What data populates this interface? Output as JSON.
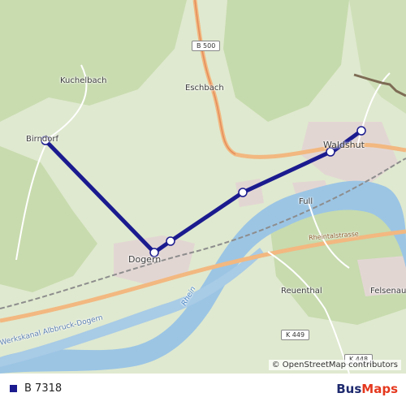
{
  "map": {
    "labels": {
      "kuchelbach": "Kuchelbach",
      "eschbach": "Eschbach",
      "birndorf": "Birndorf",
      "waldshut": "Waldshut",
      "full": "Full",
      "dogern": "Dogern",
      "reuenthal": "Reuenthal",
      "felsenau": "Felsenau",
      "rhein": "Rhein",
      "rheintalstrasse": "Rheintalstrasse",
      "kanal": "Werkskanal Albbruck-Dogern"
    },
    "road_shields": {
      "b500": "B 500",
      "k449": "K 449",
      "k448": "K 448"
    },
    "attribution": "© OpenStreetMap contributors"
  },
  "route": {
    "name": "B 7318",
    "color": "#1b1b8f",
    "stop_count": 6
  },
  "legend": {
    "route_label": "B 7318"
  },
  "brand": {
    "part1": "Bus",
    "part2": "Maps"
  }
}
